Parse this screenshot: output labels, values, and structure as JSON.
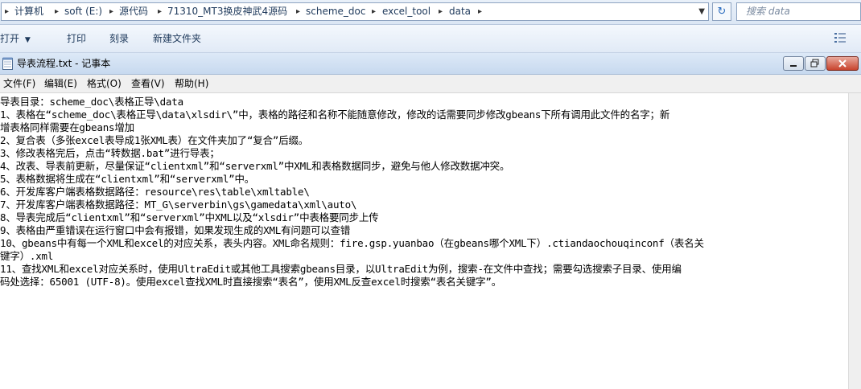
{
  "address_bar": {
    "crumbs": [
      "计算机",
      "soft (E:)",
      "源代码",
      "71310_MT3换皮神武4源码",
      "scheme_doc",
      "excel_tool",
      "data"
    ],
    "search_placeholder": "搜索 data"
  },
  "toolbar": {
    "open_label": "打开",
    "print_label": "打印",
    "burn_label": "刻录",
    "new_folder_label": "新建文件夹"
  },
  "notepad": {
    "title": "导表流程.txt - 记事本",
    "menu": [
      "文件(F)",
      "编辑(E)",
      "格式(O)",
      "查看(V)",
      "帮助(H)"
    ],
    "lines": [
      "导表目录：scheme_doc\\表格正导\\data",
      "1、表格在“scheme_doc\\表格正导\\data\\xlsdir\\”中，表格的路径和名称不能随意修改，修改的话需要同步修改gbeans下所有调用此文件的名字；新",
      "增表格同样需要在gbeans增加",
      "2、复合表（多张excel表导成1张XML表）在文件夹加了“复合”后缀。",
      "3、修改表格完后，点击“转数据.bat”进行导表；",
      "4、改表、导表前更新，尽量保证“clientxml”和“serverxml”中XML和表格数据同步，避免与他人修改数据冲突。",
      "5、表格数据将生成在“clientxml”和“serverxml”中。",
      "6、开发库客户端表格数据路径：resource\\res\\table\\xmltable\\",
      "7、开发库客户端表格数据路径：MT_G\\serverbin\\gs\\gamedata\\xml\\auto\\",
      "8、导表完成后“clientxml”和“serverxml”中XML以及“xlsdir”中表格要同步上传",
      "9、表格由严重错误在运行窗口中会有报错，如果发现生成的XML有问题可以查错",
      "10、gbeans中有每一个XML和excel的对应关系，表头内容。XML命名规则：fire.gsp.yuanbao（在gbeans哪个XML下）.ctiandaochouqinconf（表名关",
      "键字）.xml",
      "11、查找XML和excel对应关系时，使用UltraEdit或其他工具搜索gbeans目录，以UltraEdit为例，搜索-在文件中查找；需要勾选搜索子目录、使用编",
      "码处选择：65001 (UTF-8)。使用excel查找XML时直接搜索“表名”，使用XML反查excel时搜索“表名关键字”。"
    ]
  }
}
